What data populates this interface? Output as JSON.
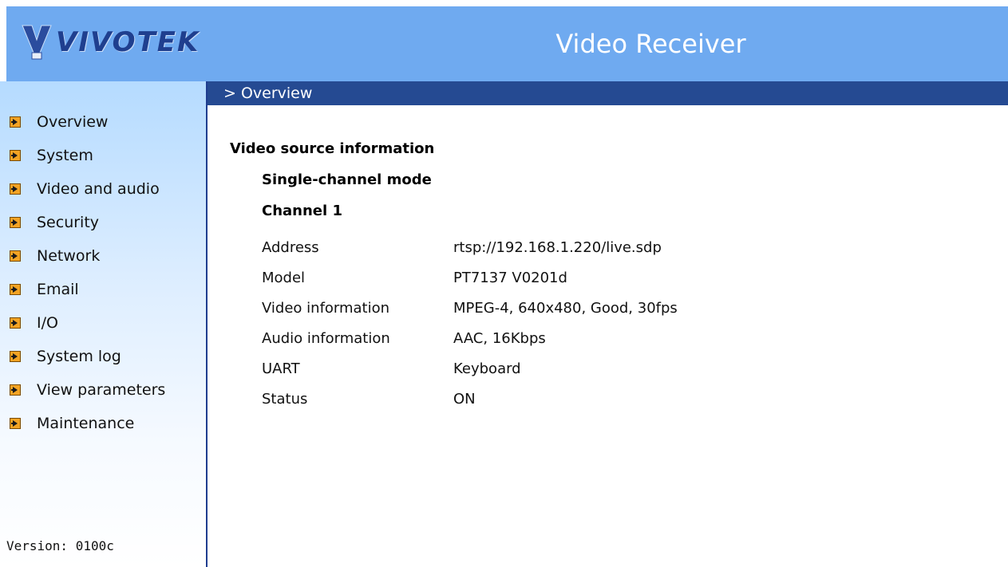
{
  "header": {
    "logo_text": "VIVOTEK",
    "title": "Video Receiver"
  },
  "sidebar": {
    "items": [
      {
        "label": "Overview",
        "icon": "arrow-right-icon"
      },
      {
        "label": "System",
        "icon": "arrow-right-icon"
      },
      {
        "label": "Video and audio",
        "icon": "arrow-right-icon"
      },
      {
        "label": "Security",
        "icon": "arrow-right-icon"
      },
      {
        "label": "Network",
        "icon": "arrow-right-icon"
      },
      {
        "label": "Email",
        "icon": "arrow-right-icon"
      },
      {
        "label": "I/O",
        "icon": "arrow-right-icon"
      },
      {
        "label": "System log",
        "icon": "arrow-right-icon"
      },
      {
        "label": "View parameters",
        "icon": "arrow-right-icon"
      },
      {
        "label": "Maintenance",
        "icon": "arrow-right-icon"
      }
    ],
    "version": "Version: 0100c"
  },
  "main": {
    "breadcrumb": "> Overview",
    "section_title": "Video source information",
    "mode": "Single-channel mode",
    "channel": "Channel 1",
    "rows": [
      {
        "key": "Address",
        "value": "rtsp://192.168.1.220/live.sdp"
      },
      {
        "key": "Model",
        "value": "PT7137 V0201d"
      },
      {
        "key": "Video information",
        "value": "MPEG-4, 640x480, Good, 30fps"
      },
      {
        "key": "Audio information",
        "value": "AAC, 16Kbps"
      },
      {
        "key": "UART",
        "value": "Keyboard"
      },
      {
        "key": "Status",
        "value": "ON"
      }
    ]
  },
  "colors": {
    "header_bg": "#6faaf0",
    "section_bar_bg": "#254a92",
    "logo_text": "#1f3f8f",
    "nav_icon": "#f2a324"
  }
}
